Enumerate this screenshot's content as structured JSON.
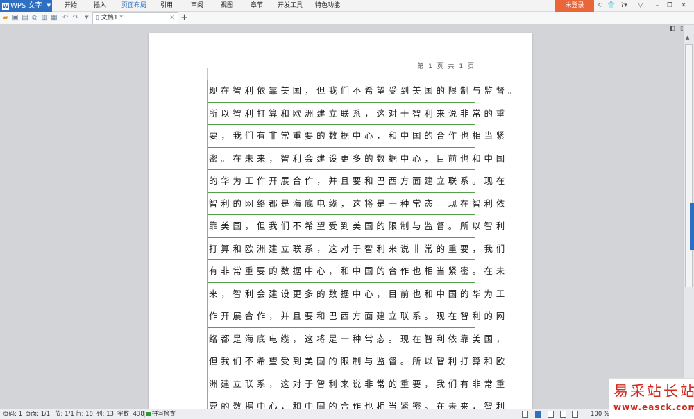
{
  "menu": {
    "app_label": "WPS 文字",
    "items": [
      "开始",
      "插入",
      "页面布局",
      "引用",
      "审阅",
      "视图",
      "章节",
      "开发工具",
      "特色功能"
    ],
    "active_index": 2,
    "login_label": "未登录",
    "help_label": "?"
  },
  "tabs": {
    "doc_title": "文档1 *"
  },
  "document": {
    "page_number": "第 1 页 共 1 页",
    "lines": [
      "现在智利依靠美国，但我们不希望受到美国的限制与监督。",
      "所以智利打算和欧洲建立联系，这对于智利来说非常的重",
      "要，我们有非常重要的数据中心，和中国的合作也相当紧",
      "密。在未来，智利会建设更多的数据中心，目前也和中国",
      "的华为工作开展合作，并且要和巴西方面建立联系。现在",
      "智利的网络都是海底电缆，这将是一种常态。现在智利依",
      "靠美国，但我们不希望受到美国的限制与监督。所以智利",
      "打算和欧洲建立联系，这对于智利来说非常的重要，我们",
      "有非常重要的数据中心，和中国的合作也相当紧密。在未",
      "来，智利会建设更多的数据中心，目前也和中国的华为工",
      "作开展合作，并且要和巴西方面建立联系。现在智利的网",
      "络都是海底电缆，这将是一种常态。现在智利依靠美国，",
      "但我们不希望受到美国的限制与监督。所以智利打算和欧",
      "洲建立联系，这对于智利来说非常的重要，我们有非常重",
      "要的数据中心，和中国的合作也相当紧密。在未来，智利"
    ]
  },
  "status": {
    "page": "页码: 1",
    "pages": "页面: 1/1",
    "section": "节: 1/1",
    "line": "行: 18",
    "column": "列: 13",
    "word_count": "字数: 438",
    "spell": "拼写检查",
    "zoom": "100 %"
  },
  "watermark": {
    "title": "易采站长站",
    "url": "www.easck.com"
  },
  "colors": {
    "accent_blue": "#2d6fc2",
    "login_orange": "#e9653a",
    "grid_green": "#55a04a",
    "watermark_red": "#d32a1f"
  }
}
